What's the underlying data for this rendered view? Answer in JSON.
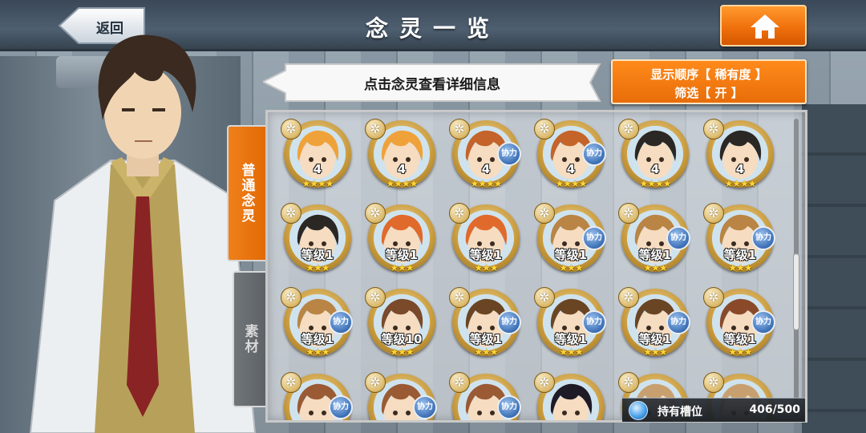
{
  "header": {
    "back_label": "返回",
    "title": "念灵一览"
  },
  "hint": "点击念灵查看详细信息",
  "sort": {
    "line1": "显示顺序【 稀有度 】",
    "line2": "筛选【 开 】"
  },
  "tabs": {
    "normal": "普通念灵",
    "material": "素材"
  },
  "slots": {
    "label": "持有槽位",
    "value": "406/500"
  },
  "colors": {
    "accent_orange": "#e86d0a",
    "assist_blue": "#3b6fb5",
    "star_gold": "#ffd53a"
  },
  "cards": [
    {
      "level": "4",
      "stars": "★★★★",
      "assist": "",
      "hair": "#f0a23a",
      "badge": "✲"
    },
    {
      "level": "4",
      "stars": "★★★★",
      "assist": "",
      "hair": "#f0a23a",
      "badge": "✲"
    },
    {
      "level": "4",
      "stars": "★★★★",
      "assist": "协力",
      "hair": "#c4632a",
      "badge": "✲"
    },
    {
      "level": "4",
      "stars": "★★★★",
      "assist": "协力",
      "hair": "#c4632a",
      "badge": "✲"
    },
    {
      "level": "4",
      "stars": "★★★★",
      "assist": "",
      "hair": "#2a2724",
      "badge": "✲"
    },
    {
      "level": "4",
      "stars": "★★★★",
      "assist": "",
      "hair": "#2a2724",
      "badge": "✲"
    },
    {
      "level": "等级1",
      "stars": "★★★",
      "assist": "",
      "hair": "#2a2724",
      "badge": "✲"
    },
    {
      "level": "等级1",
      "stars": "★★★",
      "assist": "",
      "hair": "#e06a2c",
      "badge": "✲"
    },
    {
      "level": "等级1",
      "stars": "★★★",
      "assist": "",
      "hair": "#e06a2c",
      "badge": "✲"
    },
    {
      "level": "等级1",
      "stars": "★★★",
      "assist": "协力",
      "hair": "#b98444",
      "badge": "✲"
    },
    {
      "level": "等级1",
      "stars": "★★★",
      "assist": "协力",
      "hair": "#b98444",
      "badge": "✲"
    },
    {
      "level": "等级1",
      "stars": "★★★",
      "assist": "协力",
      "hair": "#b98444",
      "badge": "✲"
    },
    {
      "level": "等级1",
      "stars": "★★★",
      "assist": "协力",
      "hair": "#b98444",
      "badge": "✲"
    },
    {
      "level": "等级10",
      "stars": "★★★",
      "assist": "",
      "hair": "#7a4a2a",
      "badge": "✲"
    },
    {
      "level": "等级1",
      "stars": "★★★",
      "assist": "协力",
      "hair": "#6a4524",
      "badge": "✲"
    },
    {
      "level": "等级1",
      "stars": "★★★",
      "assist": "协力",
      "hair": "#6a4524",
      "badge": "✲"
    },
    {
      "level": "等级1",
      "stars": "★★★",
      "assist": "协力",
      "hair": "#6a4524",
      "badge": "✲"
    },
    {
      "level": "等级1",
      "stars": "★★★",
      "assist": "协力",
      "hair": "#8a4a2a",
      "badge": "✲"
    },
    {
      "level": "",
      "stars": "",
      "assist": "协力",
      "hair": "#9a5a34",
      "badge": "✲"
    },
    {
      "level": "",
      "stars": "",
      "assist": "协力",
      "hair": "#9a5a34",
      "badge": "✲"
    },
    {
      "level": "",
      "stars": "",
      "assist": "协力",
      "hair": "#9a5a34",
      "badge": "✲"
    },
    {
      "level": "",
      "stars": "",
      "assist": "",
      "hair": "#1e1a26",
      "badge": "✲"
    },
    {
      "level": "",
      "stars": "",
      "assist": "",
      "hair": "#c8a070",
      "badge": "✲"
    },
    {
      "level": "",
      "stars": "",
      "assist": "",
      "hair": "#c8a070",
      "badge": "✲"
    }
  ]
}
